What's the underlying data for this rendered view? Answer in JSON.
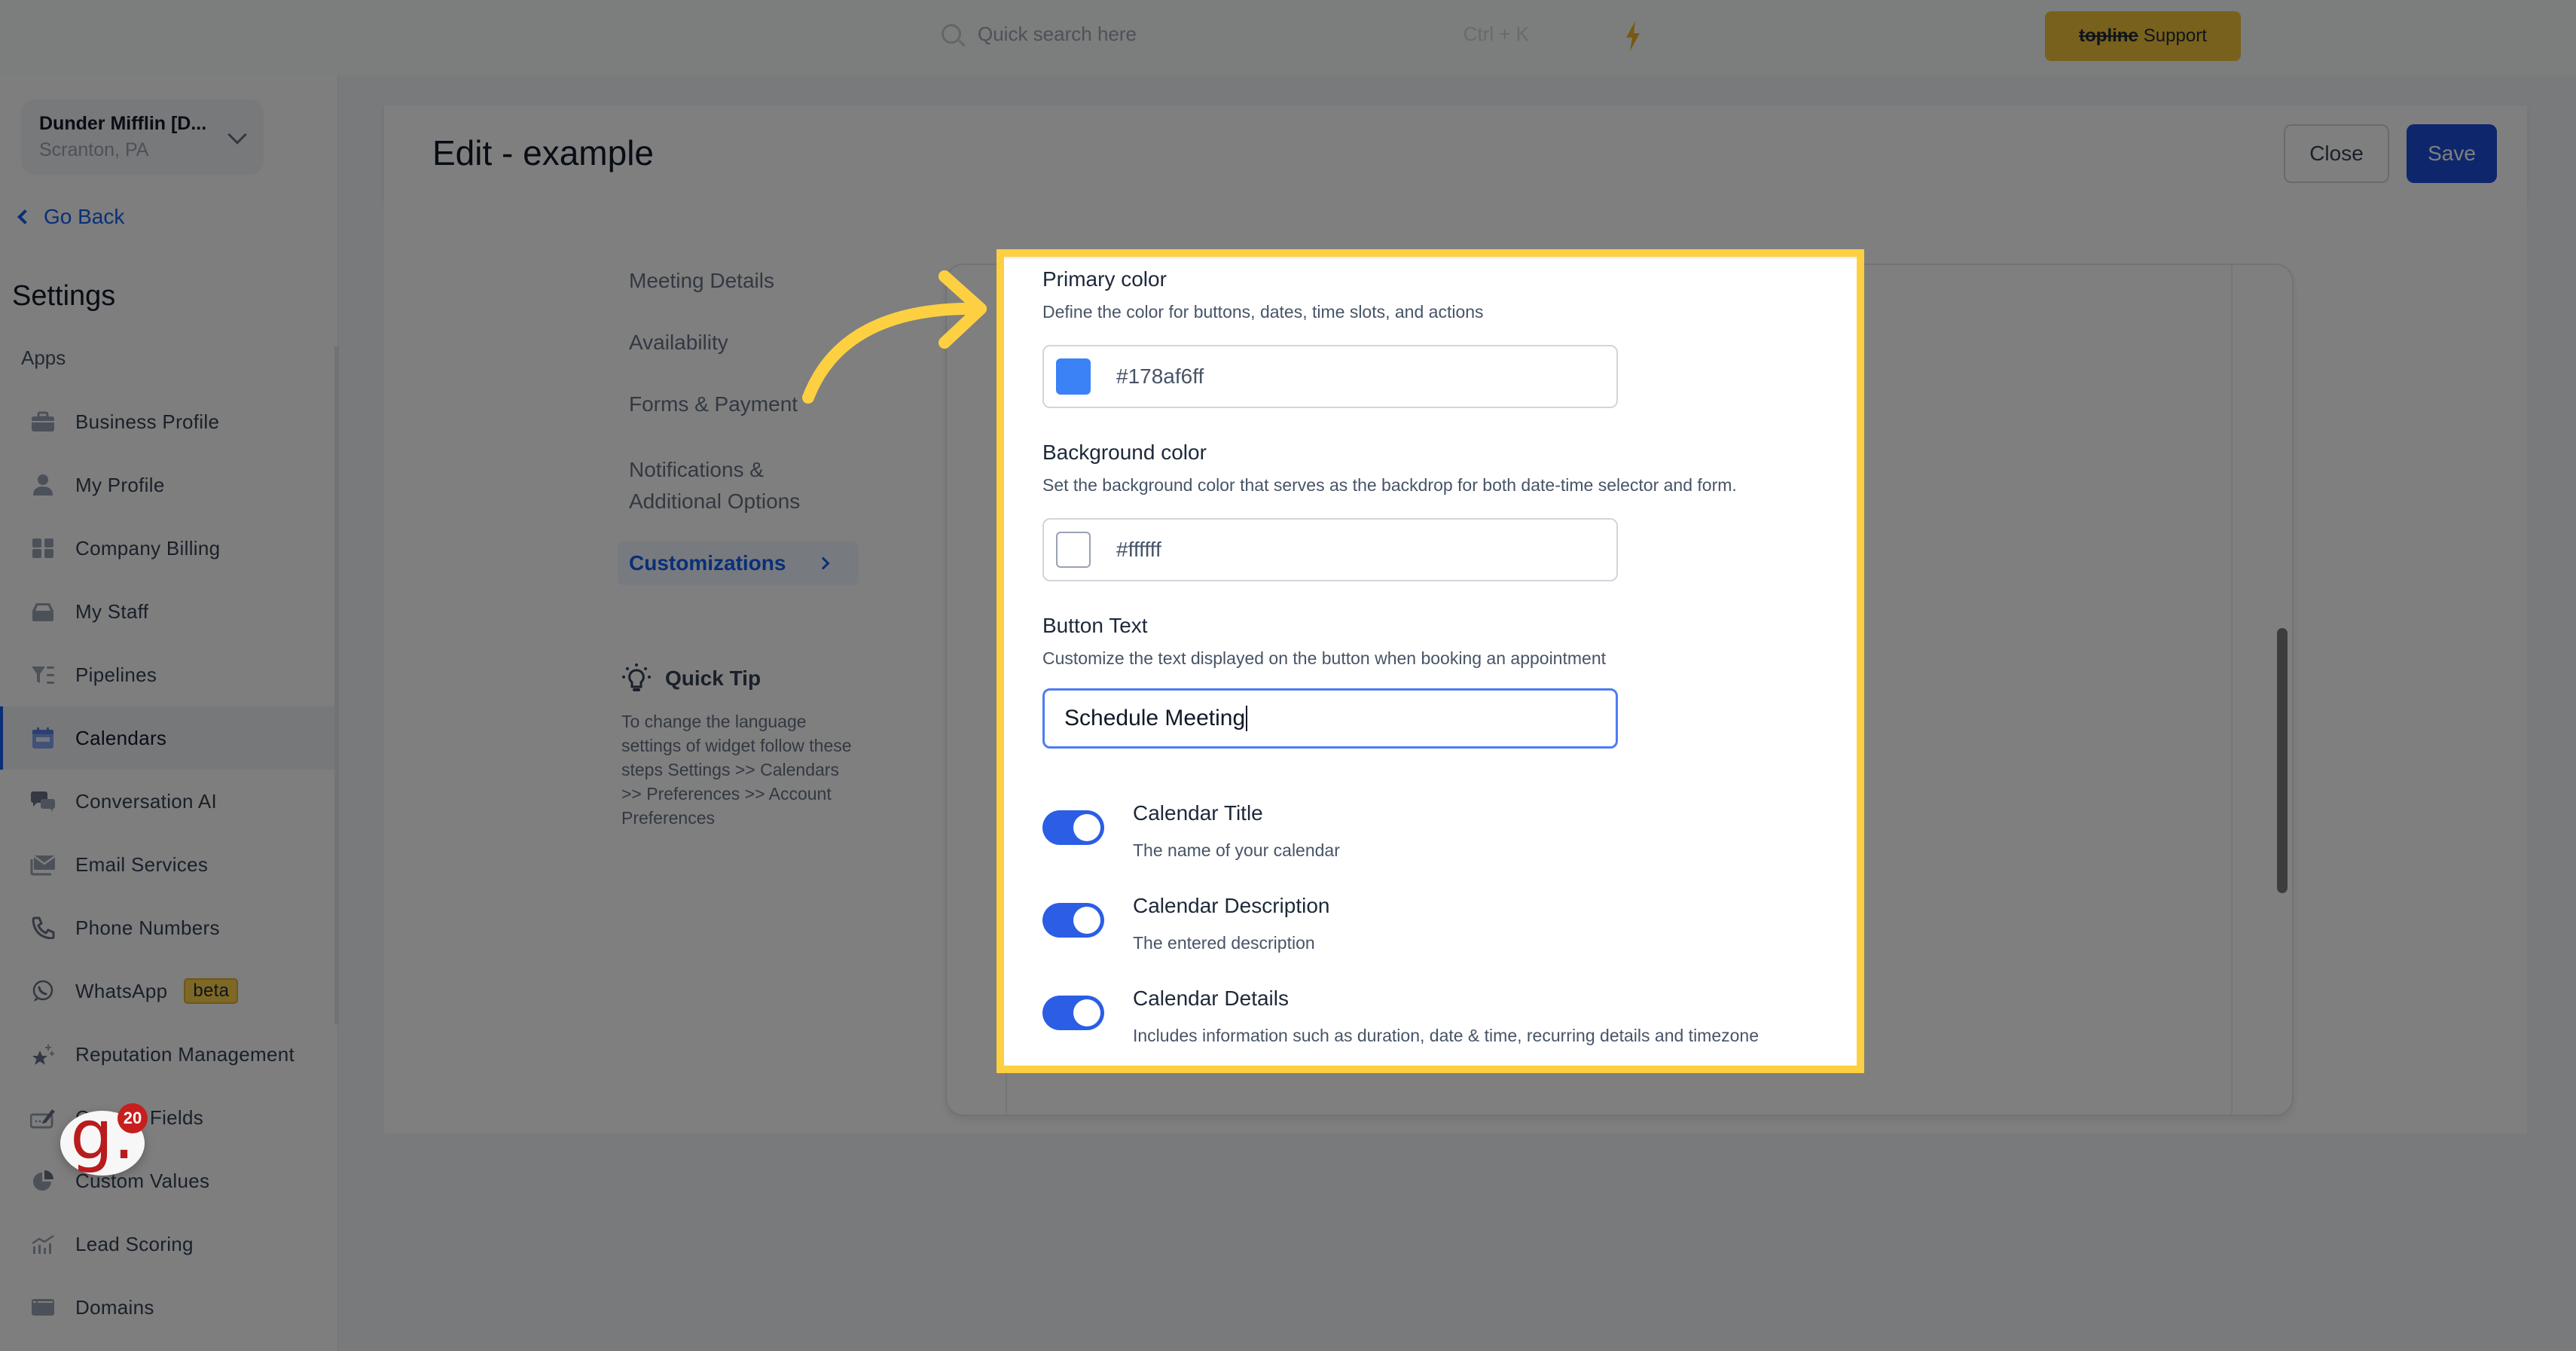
{
  "topbar": {
    "search_placeholder": "Quick search here",
    "search_shortcut": "Ctrl + K",
    "support_button": {
      "brand": "topline",
      "label": "Support"
    }
  },
  "sidebar": {
    "org": {
      "name": "Dunder Mifflin [D...",
      "location": "Scranton, PA"
    },
    "go_back": "Go Back",
    "title": "Settings",
    "section_label": "Apps",
    "items": [
      {
        "label": "Business Profile",
        "icon": "briefcase-icon"
      },
      {
        "label": "My Profile",
        "icon": "user-icon"
      },
      {
        "label": "Company Billing",
        "icon": "calculator-icon"
      },
      {
        "label": "My Staff",
        "icon": "inbox-tray-icon"
      },
      {
        "label": "Pipelines",
        "icon": "funnel-list-icon"
      },
      {
        "label": "Calendars",
        "icon": "calendar-icon",
        "active": true
      },
      {
        "label": "Conversation AI",
        "icon": "chat-bubbles-icon"
      },
      {
        "label": "Email Services",
        "icon": "mail-icon"
      },
      {
        "label": "Phone Numbers",
        "icon": "phone-icon"
      },
      {
        "label": "WhatsApp",
        "icon": "whatsapp-icon",
        "badge": "beta"
      },
      {
        "label": "Reputation Management",
        "icon": "star-sparkle-icon"
      },
      {
        "label": "Custom Fields",
        "icon": "edit-field-icon"
      },
      {
        "label": "Custom Values",
        "icon": "pie-chart-icon"
      },
      {
        "label": "Lead Scoring",
        "icon": "chart-trend-icon"
      },
      {
        "label": "Domains",
        "icon": "browser-window-icon"
      }
    ],
    "widget_badge_count": "20",
    "widget_letter": "g."
  },
  "header": {
    "title": "Edit - example",
    "close_label": "Close",
    "save_label": "Save"
  },
  "tabs": [
    {
      "label": "Meeting Details"
    },
    {
      "label": "Availability"
    },
    {
      "label": "Forms & Payment"
    },
    {
      "label": "Notifications & Additional Options"
    },
    {
      "label": "Customizations",
      "active": true
    }
  ],
  "quick_tip": {
    "title": "Quick Tip",
    "body": "To change the language settings of widget follow these steps Settings >> Calendars >> Preferences >> Account Preferences"
  },
  "customizations": {
    "primary_color": {
      "label": "Primary color",
      "description": "Define the color for buttons, dates, time slots, and actions",
      "value": "#178af6ff",
      "swatch": "#3b82f6"
    },
    "background_color": {
      "label": "Background color",
      "description": "Set the background color that serves as the backdrop for both date-time selector and form.",
      "value": "#ffffff",
      "swatch": "#ffffff"
    },
    "button_text": {
      "label": "Button Text",
      "description": "Customize the text displayed on the button when booking an appointment",
      "value": "Schedule Meeting"
    },
    "toggles": [
      {
        "title": "Calendar Title",
        "description": "The name of your calendar",
        "on": true
      },
      {
        "title": "Calendar Description",
        "description": "The entered description",
        "on": true
      },
      {
        "title": "Calendar Details",
        "description": "Includes information such as duration, date & time, recurring details and timezone",
        "on": true
      }
    ]
  },
  "colors": {
    "accent": "#155eef",
    "save_button": "#1d4ed8",
    "toggle_on": "#2b5ee5",
    "highlight": "#fdd042",
    "support_button": "#f0c239"
  }
}
